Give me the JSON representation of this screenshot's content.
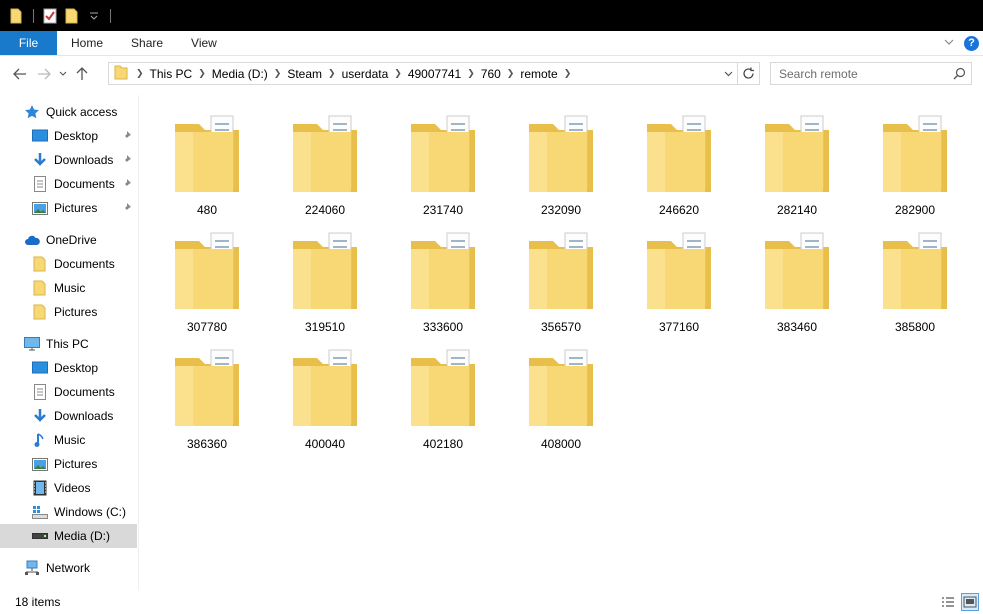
{
  "ribbon": {
    "tabs": [
      {
        "label": "File"
      },
      {
        "label": "Home"
      },
      {
        "label": "Share"
      },
      {
        "label": "View"
      }
    ]
  },
  "address": {
    "crumbs": [
      "This PC",
      "Media (D:)",
      "Steam",
      "userdata",
      "49007741",
      "760",
      "remote"
    ]
  },
  "search": {
    "placeholder": "Search remote"
  },
  "sidebar": {
    "quick_access": {
      "label": "Quick access",
      "items": [
        {
          "label": "Desktop"
        },
        {
          "label": "Downloads"
        },
        {
          "label": "Documents"
        },
        {
          "label": "Pictures"
        }
      ]
    },
    "onedrive": {
      "label": "OneDrive",
      "items": [
        {
          "label": "Documents"
        },
        {
          "label": "Music"
        },
        {
          "label": "Pictures"
        }
      ]
    },
    "this_pc": {
      "label": "This PC",
      "items": [
        {
          "label": "Desktop"
        },
        {
          "label": "Documents"
        },
        {
          "label": "Downloads"
        },
        {
          "label": "Music"
        },
        {
          "label": "Pictures"
        },
        {
          "label": "Videos"
        },
        {
          "label": "Windows (C:)"
        },
        {
          "label": "Media (D:)"
        }
      ]
    },
    "network": {
      "label": "Network"
    }
  },
  "folders": [
    "480",
    "224060",
    "231740",
    "232090",
    "246620",
    "282140",
    "282900",
    "307780",
    "319510",
    "333600",
    "356570",
    "377160",
    "383460",
    "385800",
    "386360",
    "400040",
    "402180",
    "408000"
  ],
  "status": {
    "item_count": "18 items"
  },
  "colors": {
    "file_tab": "#1979ca",
    "selection": "#d9d9d9",
    "folder": "#f7d774"
  }
}
